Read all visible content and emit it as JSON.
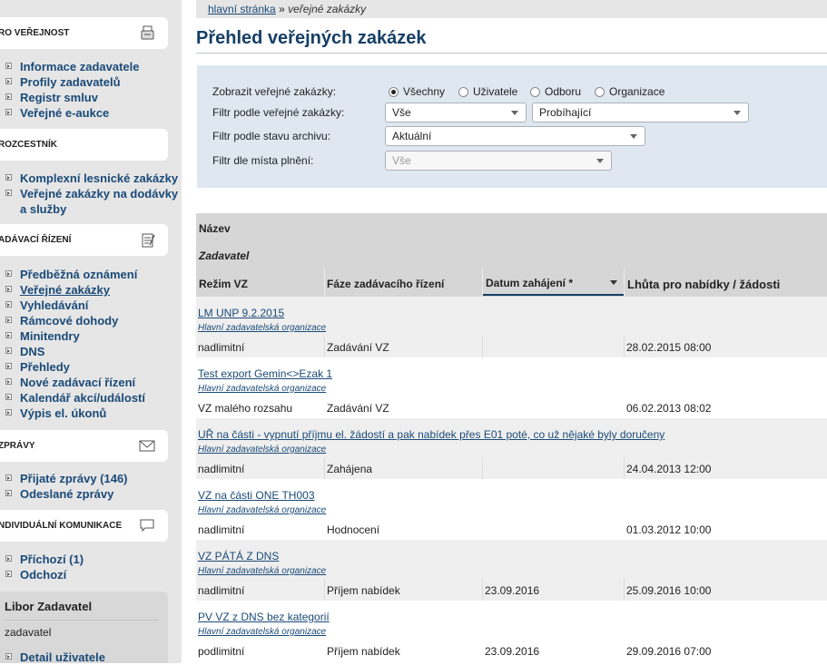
{
  "breadcrumb": {
    "home": "hlavní stránka",
    "sep": "»",
    "current": "veřejné zakázky"
  },
  "page": {
    "title": "Přehled veřejných zakázek"
  },
  "sidebar": {
    "sections": [
      {
        "title": "RO VEŘEJNOST",
        "icon": "document-icon",
        "items": [
          "Informace zadavatele",
          "Profily zadavatelů",
          "Registr smluv",
          "Veřejné e-aukce"
        ]
      },
      {
        "title": "ROZCESTNÍK",
        "icon": "",
        "items": [
          "Komplexní lesnické zakázky",
          "Veřejné zakázky na dodávky",
          "a služby"
        ]
      },
      {
        "title": "ADÁVACÍ ŘÍZENÍ",
        "icon": "notepad-icon",
        "items": [
          "Předběžná oznámení",
          "Veřejné zakázky",
          "Vyhledávání",
          "Rámcové dohody",
          "Minitendry",
          "DNS",
          "Přehledy",
          "Nové zadávací řízení",
          "Kalendář akcí/událostí",
          "Výpis el. úkonů"
        ]
      },
      {
        "title": "ZPRÁVY",
        "icon": "envelope-icon",
        "items": [
          "Přijaté zprávy (146)",
          "Odeslané zprávy"
        ]
      },
      {
        "title": "NDIVIDUÁLNÍ KOMUNIKACE",
        "icon": "speech-bubble-icon",
        "items": [
          "Příchozí (1)",
          "Odchozí"
        ]
      }
    ],
    "user": {
      "name": "Libor Zadavatel",
      "role": "zadavatel",
      "detail": "Detail uživatele"
    }
  },
  "filters": {
    "show_label": "Zobrazit veřejné zakázky:",
    "radios": [
      "Všechny",
      "Uživatele",
      "Odboru",
      "Organizace"
    ],
    "radio_selected": "Všechny",
    "filter_label": "Filtr podle veřejné zakázky:",
    "filter_value_1": "Vše",
    "filter_value_2": "Probíhající",
    "archive_label": "Filtr podle stavu archivu:",
    "archive_value": "Aktuální",
    "place_label": "Filtr dle místa plnění:",
    "place_value": "Vše"
  },
  "table": {
    "headers": {
      "name": "Název",
      "contractor": "Zadavatel",
      "mode": "Režim VZ",
      "phase": "Fáze zadávacího řízení",
      "start": "Datum zahájení *",
      "deadline": "Lhůta pro nabídky / žádosti"
    },
    "rows": [
      {
        "name": "LM UNP 9.2.2015",
        "org": "Hlavní zadavatelská organizace",
        "mode": "nadlimitní",
        "phase": "Zadávání VZ",
        "start": "",
        "deadline": "28.02.2015 08:00"
      },
      {
        "name": "Test export Gemin<>Ezak 1",
        "org": "Hlavní zadavatelská organizace",
        "mode": "VZ malého rozsahu",
        "phase": "Zadávání VZ",
        "start": "",
        "deadline": "06.02.2013 08:02"
      },
      {
        "name": "UŘ na části - vypnutí příjmu el. žádostí a pak nabídek přes E01 poté, co už nějaké byly doručeny",
        "org": "Hlavní zadavatelská organizace",
        "mode": "nadlimitní",
        "phase": "Zahájena",
        "start": "",
        "deadline": "24.04.2013 12:00"
      },
      {
        "name": "VZ na části ONE TH003",
        "org": "Hlavní zadavatelská organizace",
        "mode": "nadlimitní",
        "phase": "Hodnocení",
        "start": "",
        "deadline": "01.03.2012 10:00"
      },
      {
        "name": "VZ PÁTÁ Z DNS",
        "org": "Hlavní zadavatelská organizace",
        "mode": "nadlimitní",
        "phase": "Příjem nabídek",
        "start": "23.09.2016",
        "deadline": "25.09.2016 10:00"
      },
      {
        "name": "PV VZ z DNS bez kategorií",
        "org": "Hlavní zadavatelská organizace",
        "mode": "podlimitní",
        "phase": "Příjem nabídek",
        "start": "23.09.2016",
        "deadline": "29.09.2016 07:00"
      }
    ]
  }
}
